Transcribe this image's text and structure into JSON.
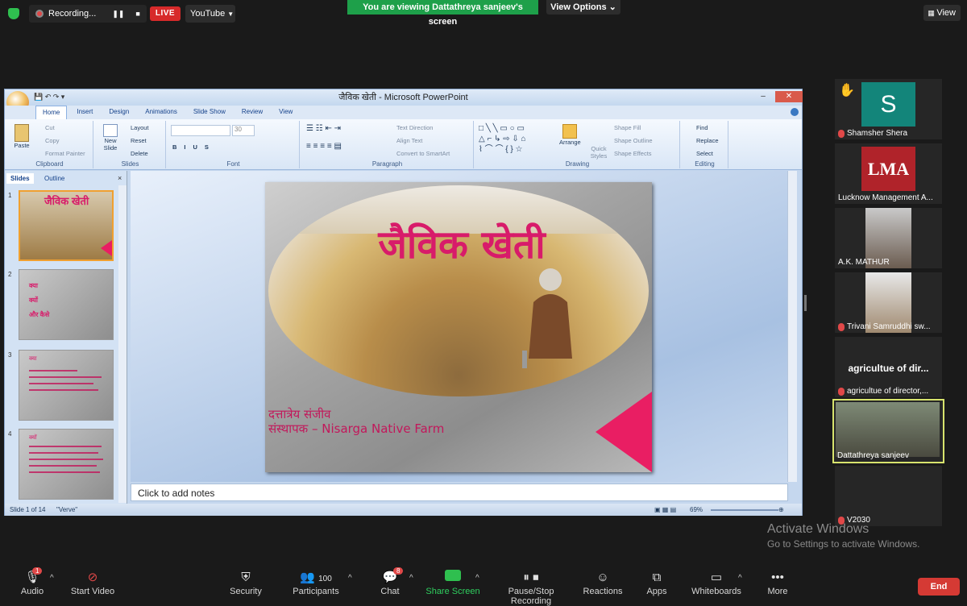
{
  "topbar": {
    "recording_label": "Recording...",
    "live_label": "LIVE",
    "youtube_label": "YouTube",
    "viewing_banner": "You are viewing Dattathreya sanjeev's screen",
    "view_options": "View Options",
    "view_label": "View"
  },
  "ppt": {
    "window_title": "जैविक खेती - Microsoft PowerPoint",
    "tabs": [
      "Home",
      "Insert",
      "Design",
      "Animations",
      "Slide Show",
      "Review",
      "View"
    ],
    "clipboard": {
      "paste": "Paste",
      "cut": "Cut",
      "copy": "Copy",
      "format_painter": "Format Painter",
      "group": "Clipboard"
    },
    "slides_grp": {
      "new_slide": "New Slide",
      "layout": "Layout",
      "reset": "Reset",
      "delete": "Delete",
      "group": "Slides"
    },
    "font_grp": {
      "size": "30",
      "group": "Font"
    },
    "paragraph_grp": {
      "text_direction": "Text Direction",
      "align_text": "Align Text",
      "convert": "Convert to SmartArt",
      "group": "Paragraph"
    },
    "drawing_grp": {
      "arrange": "Arrange",
      "quick_styles": "Quick Styles",
      "shape_fill": "Shape Fill",
      "shape_outline": "Shape Outline",
      "shape_effects": "Shape Effects",
      "group": "Drawing"
    },
    "editing_grp": {
      "find": "Find",
      "replace": "Replace",
      "select": "Select",
      "group": "Editing"
    },
    "panel_tabs": {
      "slides": "Slides",
      "outline": "Outline"
    },
    "thumbs": [
      {
        "num": "1",
        "title": "जैविक खेती"
      },
      {
        "num": "2",
        "lines": [
          "क्या",
          "क्यों",
          "और कैसे"
        ]
      },
      {
        "num": "3",
        "heading": "क्या"
      },
      {
        "num": "4",
        "heading": "क्यों"
      }
    ],
    "slide": {
      "title": "जैविक  खेती",
      "author": "दत्तात्रेय संजीव",
      "founder_prefix": "संस्थापक – ",
      "farm": "Nisarga Native Farm"
    },
    "notes_placeholder": "Click to add notes",
    "status": {
      "slide_of": "Slide 1 of 14",
      "theme": "\"Verve\"",
      "zoom": "69%"
    }
  },
  "participants": [
    {
      "name": "Shamsher Shera",
      "initial": "S"
    },
    {
      "name": "Lucknow Management A...",
      "logo": "LMA"
    },
    {
      "name": "A.K. MATHUR"
    },
    {
      "name": "Trivani Samruddhi sw..."
    },
    {
      "name": "agricultue of director,...",
      "title": "agricultue of dir..."
    },
    {
      "name": "Dattathreya sanjeev"
    },
    {
      "name": "V2030"
    }
  ],
  "watermark": {
    "line1": "Activate Windows",
    "line2": "Go to Settings to activate Windows."
  },
  "toolbar": {
    "audio": "Audio",
    "audio_badge": "1",
    "start_video": "Start Video",
    "security": "Security",
    "participants": "Participants",
    "participants_count": "100",
    "chat": "Chat",
    "chat_badge": "8",
    "share_screen": "Share Screen",
    "pause_recording": "Pause/Stop Recording",
    "reactions": "Reactions",
    "apps": "Apps",
    "whiteboards": "Whiteboards",
    "more": "More",
    "end": "End"
  },
  "colors": {
    "share_green": "#1ea04a",
    "live_red": "#d72a2a",
    "slide_pink": "#d81b6a",
    "end_red": "#d53a34"
  }
}
